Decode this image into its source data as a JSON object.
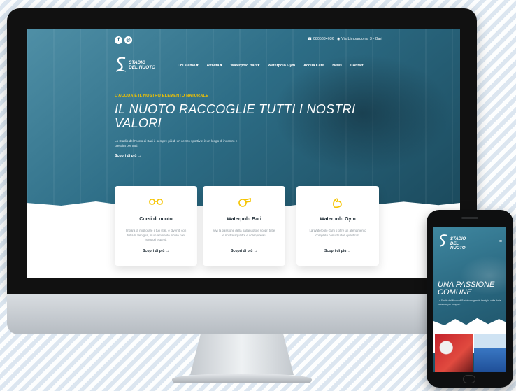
{
  "desktop": {
    "social": [
      "f",
      "◎"
    ],
    "contact": {
      "phone": "☎ 0805634036",
      "address": "◉ Via Limbardona, 3 - Bari"
    },
    "logo": {
      "text": "STADIO\nDEL NUOTO"
    },
    "nav": [
      {
        "label": "Chi siamo ▾"
      },
      {
        "label": "Attività ▾"
      },
      {
        "label": "Waterpolo Bari ▾"
      },
      {
        "label": "Waterpolo Gym"
      },
      {
        "label": "Acqua Cafè"
      },
      {
        "label": "News"
      },
      {
        "label": "Contatti"
      }
    ],
    "hero": {
      "eyebrow": "L'ACQUA È IL NOSTRO ELEMENTO NATURALE",
      "title": "IL NUOTO RACCOGLIE TUTTI I NOSTRI VALORI",
      "subtitle": "Lo Stadio del Nuoto di Bari è sempre più di un centro sportivo: è un luogo di incontro e crescita per tutti.",
      "cta": "Scopri di più →"
    },
    "cards": [
      {
        "icon": "goggles-icon",
        "title": "Corsi di nuoto",
        "desc": "Impara la migliorare il tuo stile, e divertiti con tutta la famiglia, in un ambiente sicuro con istruttori esperti.",
        "link": "Scopri di più →"
      },
      {
        "icon": "whistle-icon",
        "title": "Waterpolo Bari",
        "desc": "Vivi la passione della pallanuoto e scopri tutte le nostre squadre e i campionati.",
        "link": "Scopri di più →"
      },
      {
        "icon": "flexed-arm-icon",
        "title": "Waterpolo Gym",
        "desc": "La Waterpolo Gym ti offre un allenamento completo con istruttori qualificati.",
        "link": "Scopri di più →"
      }
    ]
  },
  "mobile": {
    "logo": {
      "text": "STADIO\nDEL NUOTO"
    },
    "menu_icon": "≡",
    "title": "UNA PASSIONE COMUNE",
    "subtitle": "Lo Stadio del Nuoto di Bari è una grande famiglia unita dalla passione per lo sport."
  },
  "colors": {
    "accent_yellow": "#f5c400",
    "hero_blue": "#2d6d86",
    "device_frame": "#111111"
  }
}
